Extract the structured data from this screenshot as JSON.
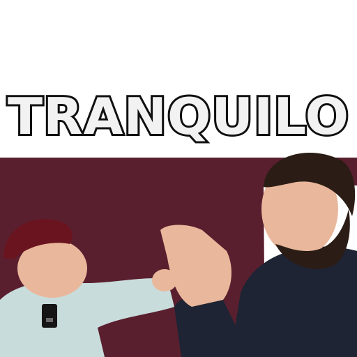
{
  "caption": "TRANQUILO",
  "colors": {
    "backdrop": "#5a1f2e",
    "text_fill": "#f2f2f2",
    "text_outline": "#101010",
    "shirt_light": "#c9dcdc",
    "shirt_dark": "#1e2433",
    "hat": "#6a1420",
    "skin": "#e9b79b",
    "hair": "#2b1d16"
  }
}
